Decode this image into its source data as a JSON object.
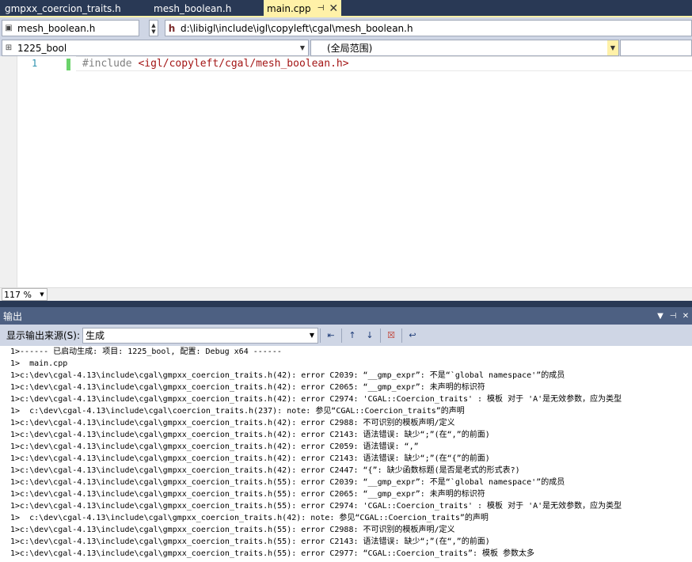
{
  "tabs": [
    {
      "label": "gmpxx_coercion_traits.h",
      "active": false
    },
    {
      "label": "mesh_boolean.h",
      "active": false
    },
    {
      "label": "main.cpp",
      "active": true
    }
  ],
  "nav": {
    "file_combo": "mesh_boolean.h",
    "file_path": "d:\\libigl\\include\\igl\\copyleft\\cgal\\mesh_boolean.h",
    "project_combo": "1225_bool",
    "scope_combo": "(全局范围)"
  },
  "editor": {
    "line_number": "1",
    "code_keyword": "#include ",
    "code_path": "<igl/copyleft/cgal/mesh_boolean.h>",
    "zoom": "117 %"
  },
  "output": {
    "title": "输出",
    "source_label": "显示输出来源(S):",
    "source_value": "生成",
    "lines": [
      "1>------ 已启动生成: 项目: 1225_bool, 配置: Debug x64 ------",
      "1>  main.cpp",
      "1>c:\\dev\\cgal-4.13\\include\\cgal\\gmpxx_coercion_traits.h(42): error C2039: “__gmp_expr”: 不是“`global namespace'”的成员",
      "1>c:\\dev\\cgal-4.13\\include\\cgal\\gmpxx_coercion_traits.h(42): error C2065: “__gmp_expr”: 未声明的标识符",
      "1>c:\\dev\\cgal-4.13\\include\\cgal\\gmpxx_coercion_traits.h(42): error C2974: 'CGAL::Coercion_traits' : 模板 对于 'A'是无效参数，应为类型",
      "1>  c:\\dev\\cgal-4.13\\include\\cgal\\coercion_traits.h(237): note: 参见“CGAL::Coercion_traits”的声明",
      "1>c:\\dev\\cgal-4.13\\include\\cgal\\gmpxx_coercion_traits.h(42): error C2988: 不可识别的模板声明/定义",
      "1>c:\\dev\\cgal-4.13\\include\\cgal\\gmpxx_coercion_traits.h(42): error C2143: 语法错误: 缺少“;”(在“,”的前面)",
      "1>c:\\dev\\cgal-4.13\\include\\cgal\\gmpxx_coercion_traits.h(42): error C2059: 语法错误: “,”",
      "1>c:\\dev\\cgal-4.13\\include\\cgal\\gmpxx_coercion_traits.h(42): error C2143: 语法错误: 缺少“;”(在“{”的前面)",
      "1>c:\\dev\\cgal-4.13\\include\\cgal\\gmpxx_coercion_traits.h(42): error C2447: “{”: 缺少函数标题(是否是老式的形式表?)",
      "1>c:\\dev\\cgal-4.13\\include\\cgal\\gmpxx_coercion_traits.h(55): error C2039: “__gmp_expr”: 不是“`global namespace'”的成员",
      "1>c:\\dev\\cgal-4.13\\include\\cgal\\gmpxx_coercion_traits.h(55): error C2065: “__gmp_expr”: 未声明的标识符",
      "1>c:\\dev\\cgal-4.13\\include\\cgal\\gmpxx_coercion_traits.h(55): error C2974: 'CGAL::Coercion_traits' : 模板 对于 'A'是无效参数，应为类型",
      "1>  c:\\dev\\cgal-4.13\\include\\cgal\\gmpxx_coercion_traits.h(42): note: 参见“CGAL::Coercion_traits”的声明",
      "1>c:\\dev\\cgal-4.13\\include\\cgal\\gmpxx_coercion_traits.h(55): error C2988: 不可识别的模板声明/定义",
      "1>c:\\dev\\cgal-4.13\\include\\cgal\\gmpxx_coercion_traits.h(55): error C2143: 语法错误: 缺少“;”(在“,”的前面)",
      "1>c:\\dev\\cgal-4.13\\include\\cgal\\gmpxx_coercion_traits.h(55): error C2977: “CGAL::Coercion_traits”: 模板 参数太多"
    ]
  },
  "colors": {
    "tab_active": "#fff1a8",
    "frame": "#293955",
    "panel_title": "#4d6082",
    "toolbar": "#cfd6e5"
  },
  "icons": [
    "pin-icon",
    "close-icon",
    "dropdown-icon",
    "header-file-icon",
    "class-icon",
    "find-message-icon",
    "prev-message-icon",
    "next-message-icon",
    "clear-all-icon",
    "word-wrap-icon"
  ]
}
